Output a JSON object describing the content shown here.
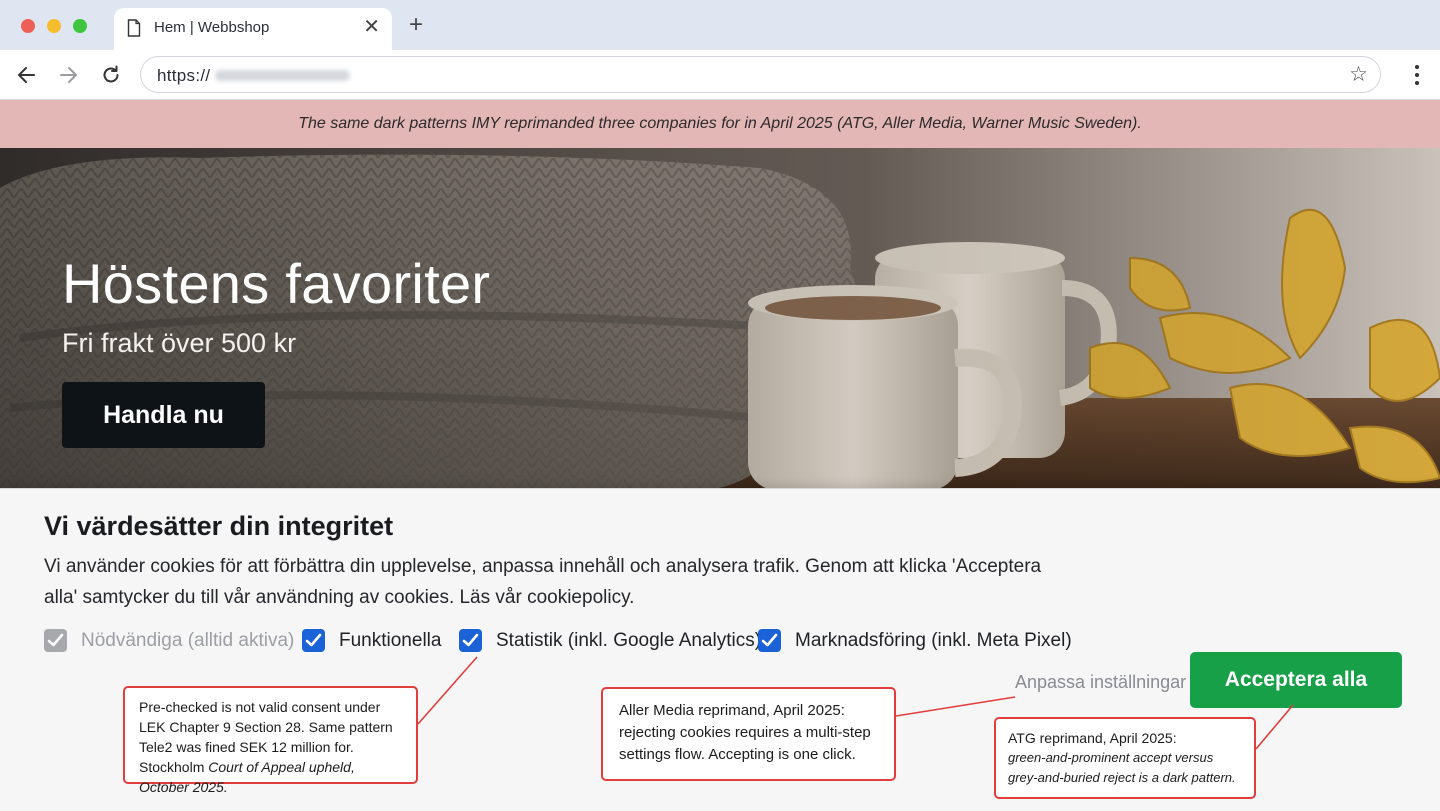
{
  "browser": {
    "tab_title": "Hem | Webbshop",
    "tab_close": "✕",
    "new_tab": "+",
    "url_prefix": "https://",
    "star": "☆"
  },
  "warning_banner": {
    "text": "The same dark patterns IMY reprimanded three companies for in April 2025 (ATG, Aller Media, Warner Music Sweden)."
  },
  "hero": {
    "title": "Höstens favoriter",
    "subtitle": "Fri frakt över 500 kr",
    "cta_label": "Handla nu"
  },
  "cookie_banner": {
    "title": "Vi värdesätter din integritet",
    "body": "Vi använder cookies för att förbättra din upplevelse, anpassa innehåll och analysera trafik. Genom att klicka 'Acceptera alla' samtycker du till vår användning av cookies. Läs vår cookiepolicy.",
    "options": [
      {
        "label": "Nödvändiga (alltid aktiva)",
        "checked": true,
        "disabled": true
      },
      {
        "label": "Funktionella",
        "checked": true,
        "disabled": false
      },
      {
        "label": "Statistik (inkl. Google Analytics)",
        "checked": true,
        "disabled": false
      },
      {
        "label": "Marknadsföring (inkl. Meta Pixel)",
        "checked": true,
        "disabled": false
      }
    ],
    "customize_label": "Anpassa inställningar",
    "accept_label": "Acceptera alla",
    "accept_color": "#17a047",
    "checkbox_color": "#1a62d6"
  },
  "annotations": {
    "precheck": {
      "line1": "Pre-checked is not valid consent under LEK Chapter 9 Section 28. Same pattern Tele2 was fined SEK 12 million for. Stockholm",
      "line2": "Court of Appeal upheld, October 2025."
    },
    "aller": {
      "text": "Aller Media reprimand, April 2025: rejecting cookies requires a multi-step settings flow. Accepting is one click."
    },
    "atg": {
      "title": "ATG reprimand, April 2025:",
      "body": "green-and-prominent accept versus grey-and-buried reject is a dark pattern."
    },
    "border_color": "#e23d3d"
  }
}
